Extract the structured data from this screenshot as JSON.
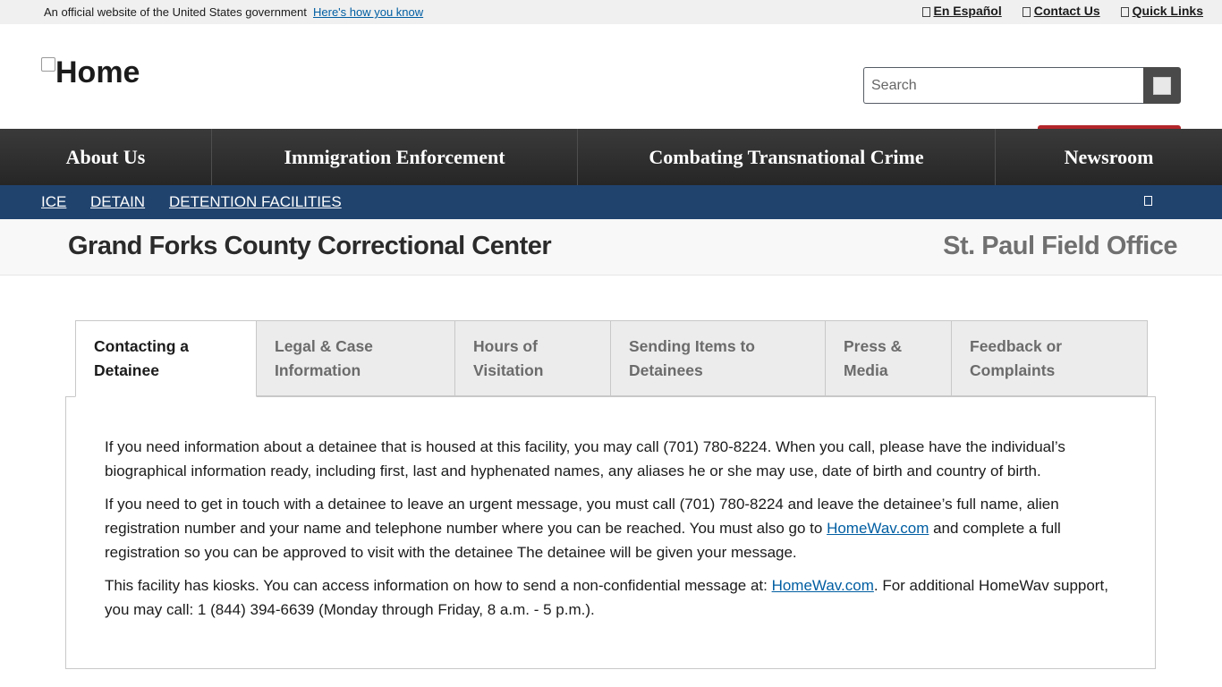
{
  "gov_banner": {
    "text": "An official website of the United States government",
    "link": "Here's how you know"
  },
  "utility_links": [
    {
      "label": "En Español",
      "icon": "globe-icon"
    },
    {
      "label": "Contact Us",
      "icon": "envelope-icon"
    },
    {
      "label": "Quick Links",
      "icon": "link-icon"
    }
  ],
  "header": {
    "logo_alt": "Home",
    "search_placeholder": "Search"
  },
  "main_nav": [
    {
      "label": "About Us"
    },
    {
      "label": "Immigration Enforcement"
    },
    {
      "label": "Combating Transnational Crime"
    },
    {
      "label": "Newsroom"
    }
  ],
  "breadcrumb": [
    "ICE",
    "DETAIN",
    "DETENTION FACILITIES"
  ],
  "facility": {
    "name": "Grand Forks County Correctional Center",
    "field_office": "St. Paul Field Office"
  },
  "tabs": [
    {
      "line1": "Contacting a",
      "line2": "Detainee",
      "active": true
    },
    {
      "line1": "Legal & Case",
      "line2": "Information",
      "active": false
    },
    {
      "line1": "Hours of",
      "line2": "Visitation",
      "active": false
    },
    {
      "line1": "Sending Items to",
      "line2": "Detainees",
      "active": false
    },
    {
      "line1": "Press &",
      "line2": "Media",
      "active": false
    },
    {
      "line1": "Feedback or",
      "line2": "Complaints",
      "active": false
    }
  ],
  "content": {
    "p1": "If you need information about a detainee that is housed at this facility, you may call (701) 780-8224. When you call, please have the individual’s biographical information ready, including first, last and hyphenated names, any aliases he or she may use, date of birth and country of birth.",
    "p2_before": "If you need to get in touch with a detainee to leave an urgent message, you must call (701) 780-8224 and leave the detainee’s full name, alien registration number and your name and telephone number where you can be reached. You must also go to ",
    "p2_link": "HomeWav.com",
    "p2_after": " and complete a full registration so you can be approved to visit with the detainee The detainee will be given your message.",
    "p3_before": "This facility has kiosks. You can access information on how to send a non-confidential message at: ",
    "p3_link": "HomeWav.com",
    "p3_after": ". For additional HomeWav support, you may call: 1 (844) 394-6639 (Monday through Friday, 8 a.m. - 5 p.m.)."
  }
}
